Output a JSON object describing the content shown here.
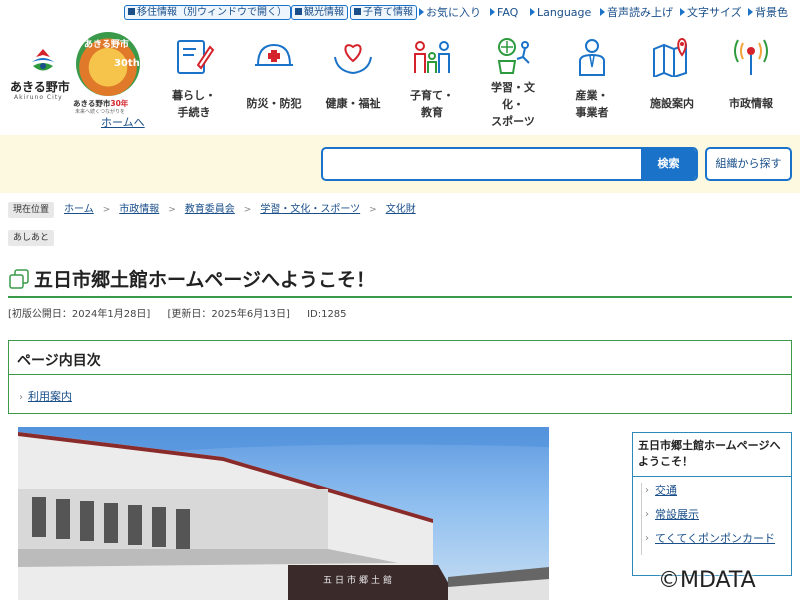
{
  "utility": {
    "pills": [
      "移住情報（別ウィンドウで開く）",
      "観光情報",
      "子育て情報"
    ],
    "links": [
      "お気に入り",
      "FAQ",
      "Language",
      "音声読み上げ",
      "文字サイズ",
      "背景色"
    ]
  },
  "logo": {
    "name": "あきる野市",
    "sub": "Akiruno City"
  },
  "anniversary": {
    "badge_top": "あきる野市",
    "badge_30": "30th",
    "title_prefix": "あきる野市",
    "title_num": "30年",
    "tagline": "未来へ続くつながりを"
  },
  "home_link": "ホームへ",
  "nav": [
    {
      "line1": "暮らし・",
      "line2": "手続き",
      "line3": ""
    },
    {
      "line1": "防災・防犯",
      "line2": "",
      "line3": ""
    },
    {
      "line1": "健康・福祉",
      "line2": "",
      "line3": ""
    },
    {
      "line1": "子育て・",
      "line2": "教育",
      "line3": ""
    },
    {
      "line1": "学習・文",
      "line2": "化・",
      "line3": "スポーツ"
    },
    {
      "line1": "産業・",
      "line2": "事業者",
      "line3": ""
    },
    {
      "line1": "施設案内",
      "line2": "",
      "line3": ""
    },
    {
      "line1": "市政情報",
      "line2": "",
      "line3": ""
    }
  ],
  "search": {
    "value": "",
    "button": "検索",
    "org_button": "組織から探す"
  },
  "breadcrumb": {
    "label": "現在位置",
    "items": [
      "ホーム",
      "市政情報",
      "教育委員会",
      "学習・文化・スポーツ",
      "文化財"
    ]
  },
  "tag": "あしあと",
  "page_title": "五日市郷土館ホームページへようこそ！",
  "meta": {
    "published": "[初版公開日：2024年1月28日]",
    "updated": "[更新日：2025年6月13日]",
    "id": "ID:1285"
  },
  "toc": {
    "title": "ページ内目次",
    "items": [
      "利用案内"
    ]
  },
  "photo": {
    "sign": "五日市郷土館"
  },
  "side": {
    "title": "五日市郷土館ホームページへようこそ！",
    "items": [
      "交通",
      "常設展示",
      "てくてくポンポンカード"
    ]
  },
  "watermark": "©MDATA"
}
